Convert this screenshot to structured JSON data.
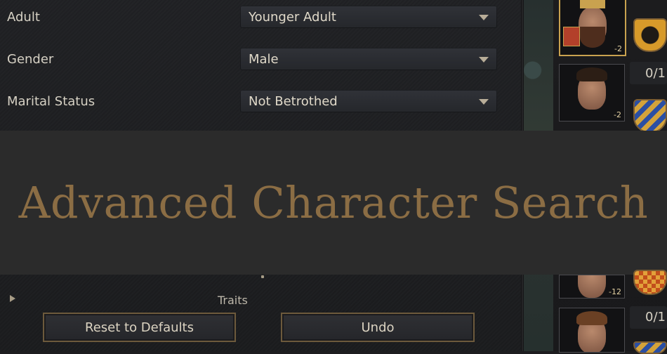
{
  "filters": [
    {
      "label": "Adult",
      "value": "Younger Adult"
    },
    {
      "label": "Gender",
      "value": "Male"
    },
    {
      "label": "Marital Status",
      "value": "Not Betrothed"
    }
  ],
  "banner": {
    "title": "Advanced Character Search"
  },
  "partial": {
    "traits": "Traits"
  },
  "footer": {
    "reset_label": "Reset to Defaults",
    "undo_label": "Undo"
  },
  "results": [
    {
      "badge": "-2",
      "count": ""
    },
    {
      "badge": "-2",
      "count": "0/1"
    },
    {
      "badge": "-12",
      "count": ""
    },
    {
      "badge": "",
      "count": "0/1"
    }
  ],
  "colors": {
    "accent_gold": "#8b6d44",
    "panel_bg": "#1d1d1f",
    "banner_bg": "#2b2b2b"
  }
}
